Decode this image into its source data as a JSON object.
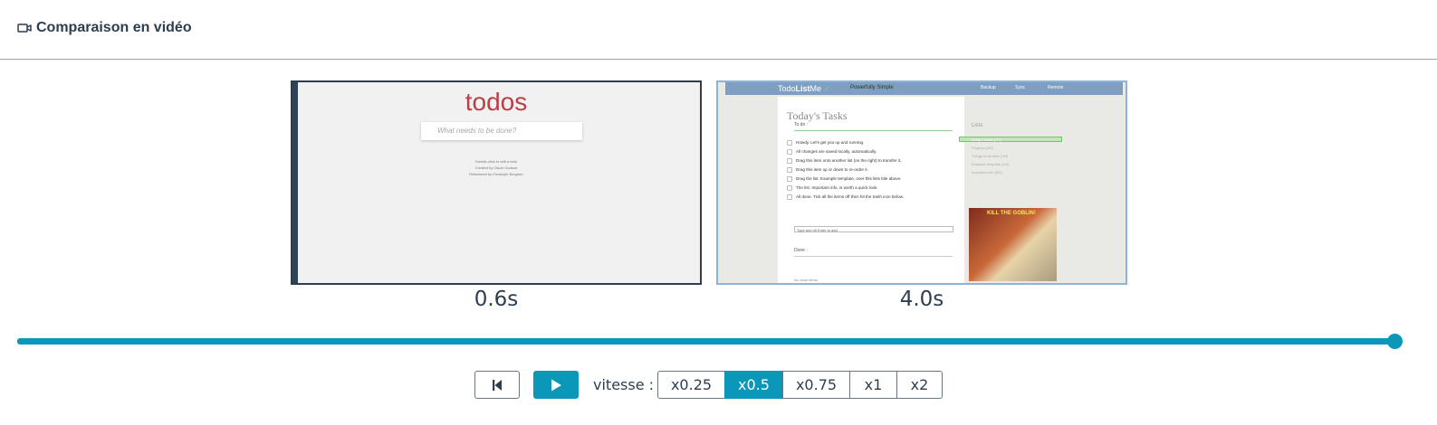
{
  "header": {
    "title": "Comparaison en vidéo",
    "icon": "video-camera-icon"
  },
  "videos": [
    {
      "time": "0.6s",
      "screen": {
        "title": "todos",
        "input_placeholder": "What needs to be done?",
        "footer": [
          "Double-click to edit a todo",
          "Created by Oscar Godson",
          "Refactored by Christoph Burgmer"
        ]
      }
    },
    {
      "time": "4.0s",
      "screen": {
        "logo_pre": "Todo",
        "logo_mid": "List",
        "logo_post": "Me",
        "tagline": "Powerfully Simple",
        "nav": [
          "Backup",
          "Sync",
          "Remote"
        ],
        "heading": "Today's Tasks",
        "todo_label": "To do :",
        "tasks": [
          "Howdy. Let's get you up and running.",
          "All changes are saved locally, automatically.",
          "Drag this item onto another list (on the right) to transfer it.",
          "Drag this item up or down to re-order it.",
          "Drag the list. Example template, over this lists title above.",
          "The list. Important info, is worth a quick look.",
          "All done. Tick all the items off then hit the trash icon below."
        ],
        "add_placeholder": "Type and hit Enter to add",
        "done_label": "Done :",
        "no_done": "No done items.",
        "lists_label": "Lists",
        "lists": [
          "Today's Tasks (7/7)",
          "Projects (0/0)",
          "Things to do later (0/0)",
          "Example template (4/4)",
          "Important info (0/0)"
        ],
        "ad_title": "KILL THE GOBLIN!"
      }
    }
  ],
  "slider": {
    "progress_percent": 100
  },
  "controls": {
    "restart_icon": "skip-back-icon",
    "play_icon": "play-icon",
    "speed_label": "vitesse :",
    "speeds": [
      "x0.25",
      "x0.5",
      "x0.75",
      "x1",
      "x2"
    ],
    "active_speed": "x0.5"
  },
  "colors": {
    "accent": "#0b97b7",
    "text": "#2c3e50",
    "border": "#6c757d"
  }
}
